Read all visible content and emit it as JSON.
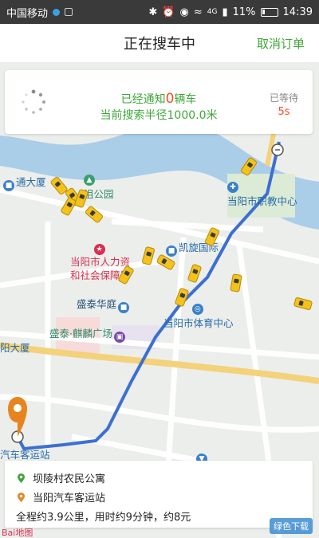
{
  "status_bar": {
    "carrier": "中国移动",
    "battery": "11%",
    "network": "4G",
    "time": "14:39"
  },
  "header": {
    "title": "正在搜车中",
    "cancel_label": "取消订单"
  },
  "search": {
    "notify_prefix": "已经通知",
    "notify_count": "0",
    "notify_suffix": "辆车",
    "radius_text": "当前搜索半径1000.0米",
    "wait_label": "已等待",
    "wait_value": "5s"
  },
  "map": {
    "pois": {
      "tong_building": "通大厦",
      "ju_park": "沮公园",
      "hr_bureau_l1": "当阳市人力资",
      "hr_bureau_l2": "和社会保障局",
      "kaixuan": "凯旋国际",
      "vocational": "当阳市职教中心",
      "shengtai": "盛泰华庭",
      "shengtai_plaza": "盛泰·麒麟广场",
      "sports": "当阳市体育中心",
      "tong_building2": "阳大厦",
      "bus_station": "汽车客运站"
    },
    "colors": {
      "water": "#aacde8",
      "road": "#ffffff",
      "route": "#3d6fd2",
      "taxi": "#f3c21b",
      "origin_pin": "#e8841d"
    }
  },
  "route": {
    "origin": "坝陵村农民公寓",
    "destination": "当阳汽车客运站",
    "summary": "全程约3.9公里，用时约9分钟，约8元"
  },
  "watermark": "绿色下载",
  "map_logo": "Bai地图"
}
